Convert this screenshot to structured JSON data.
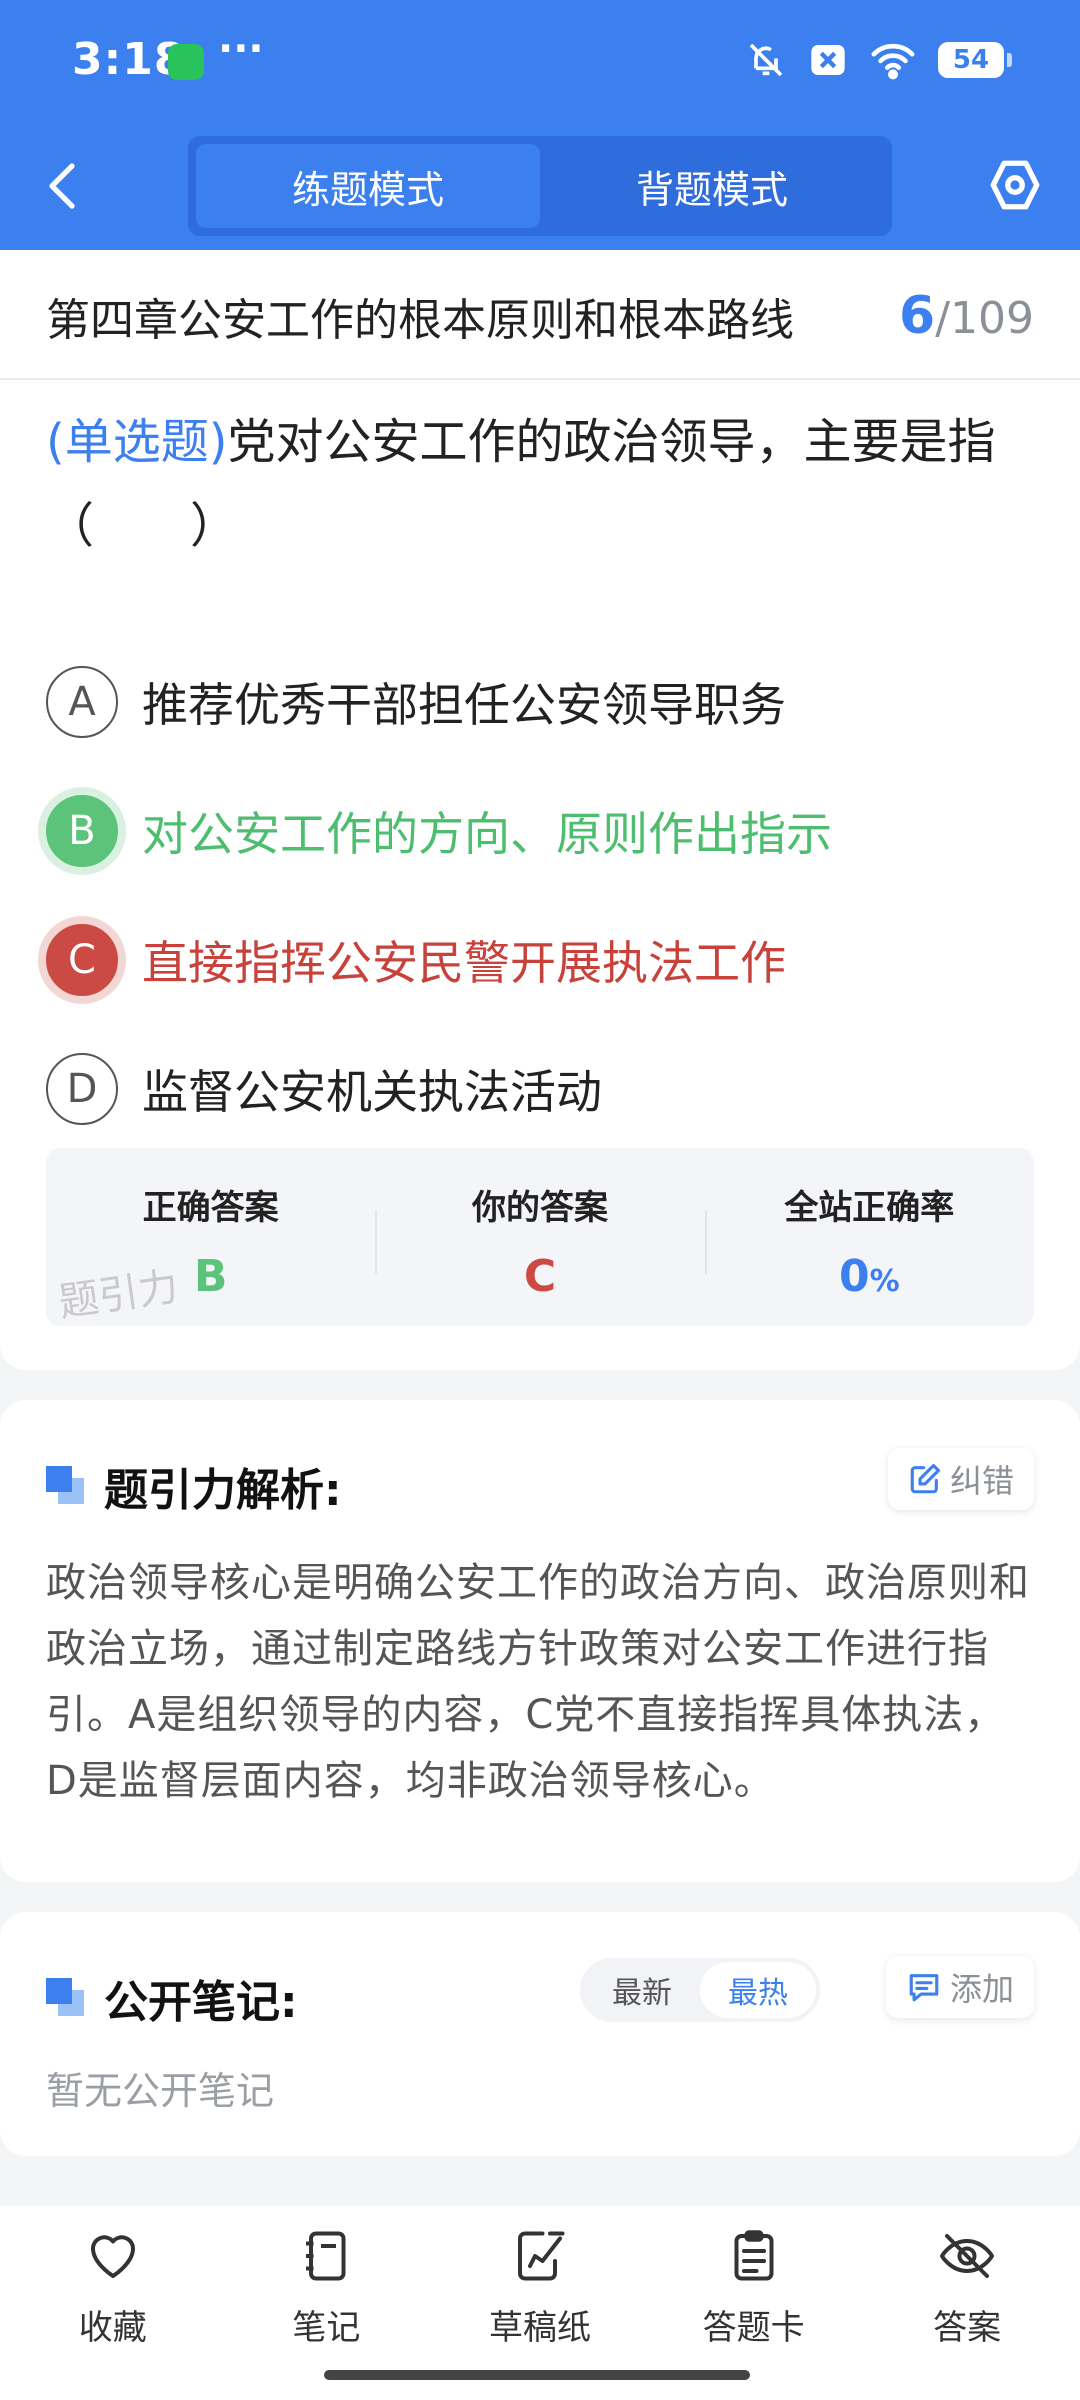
{
  "status_bar": {
    "time": "3:18",
    "dots": "···",
    "battery": "54"
  },
  "header": {
    "tabs": [
      {
        "label": "练题模式",
        "active": true
      },
      {
        "label": "背题模式",
        "active": false
      }
    ]
  },
  "chapter": {
    "title": "第四章公安工作的根本原则和根本路线",
    "current": "6",
    "total": "/109"
  },
  "question": {
    "type": "(单选题)",
    "text": "党对公安工作的政治领导，主要是指（　　）",
    "options": [
      {
        "letter": "A",
        "text": "推荐优秀干部担任公安领导职务",
        "state": "normal"
      },
      {
        "letter": "B",
        "text": "对公安工作的方向、原则作出指示",
        "state": "correct"
      },
      {
        "letter": "C",
        "text": "直接指挥公安民警开展执法工作",
        "state": "wrong"
      },
      {
        "letter": "D",
        "text": "监督公安机关执法活动",
        "state": "normal"
      }
    ]
  },
  "answer_summary": {
    "correct_label": "正确答案",
    "correct_value": "B",
    "yours_label": "你的答案",
    "yours_value": "C",
    "rate_label": "全站正确率",
    "rate_value": "0",
    "rate_unit": "%",
    "watermark": "题引力"
  },
  "analysis": {
    "title": "题引力解析:",
    "report_label": "纠错",
    "text": "政治领导核心是明确公安工作的政治方向、政治原则和政治立场，通过制定路线方针政策对公安工作进行指引。A是组织领导的内容，C党不直接指挥具体执法，D是监督层面内容，均非政治领导核心。"
  },
  "notes": {
    "title": "公开笔记:",
    "sort_latest": "最新",
    "sort_hot": "最热",
    "add_label": "添加",
    "empty": "暂无公开笔记"
  },
  "bottom_bar": [
    {
      "label": "收藏",
      "icon": "heart-icon"
    },
    {
      "label": "笔记",
      "icon": "notebook-icon"
    },
    {
      "label": "草稿纸",
      "icon": "draft-paper-icon"
    },
    {
      "label": "答题卡",
      "icon": "answer-card-icon"
    },
    {
      "label": "答案",
      "icon": "eye-off-icon"
    }
  ],
  "colors": {
    "brand": "#3c80ef",
    "correct": "#5cc47a",
    "wrong": "#cb4b44"
  }
}
